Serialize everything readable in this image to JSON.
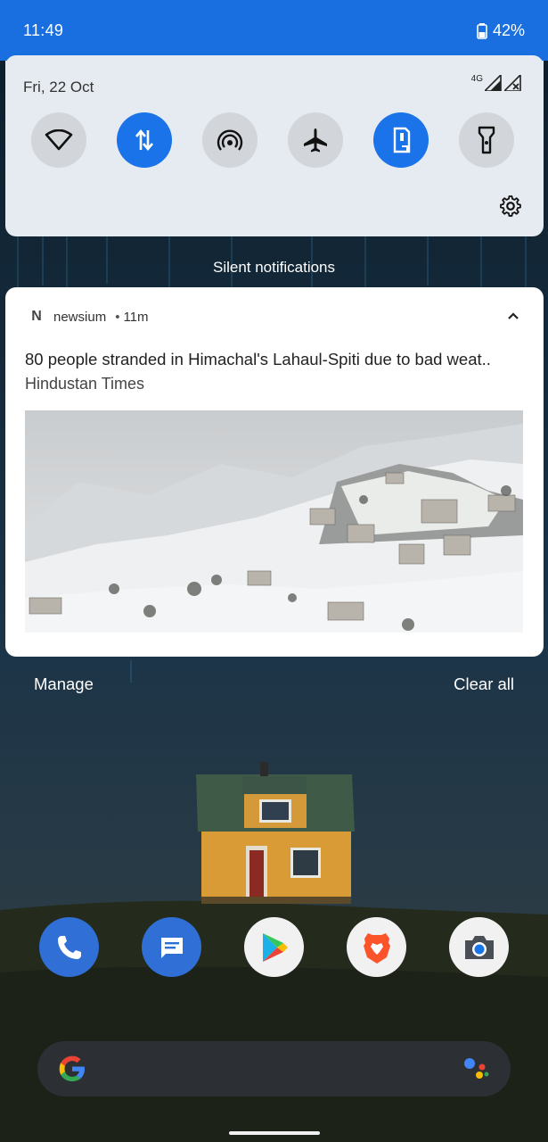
{
  "status_bar": {
    "time": "11:49",
    "battery_percent": "42%"
  },
  "quick_settings": {
    "date": "Fri, 22 Oct",
    "network_label": "4G",
    "tiles": [
      {
        "name": "wifi",
        "icon": "wifi-icon",
        "active": false
      },
      {
        "name": "mobile-data",
        "icon": "data-arrows-icon",
        "active": true
      },
      {
        "name": "hotspot",
        "icon": "hotspot-icon",
        "active": false
      },
      {
        "name": "airplane-mode",
        "icon": "airplane-icon",
        "active": false
      },
      {
        "name": "auto-rotate",
        "icon": "auto-rotate-icon",
        "active": true
      },
      {
        "name": "flashlight",
        "icon": "flashlight-icon",
        "active": false
      }
    ]
  },
  "notifications": {
    "section_label": "Silent notifications",
    "items": [
      {
        "app_icon": "N",
        "app_name": "newsium",
        "separator": "•",
        "time": "11m",
        "title": "80 people stranded in Himachal's Lahaul-Spiti due to bad weat..",
        "source": "Hindustan Times"
      }
    ],
    "manage_label": "Manage",
    "clear_all_label": "Clear all"
  },
  "dock": [
    "phone-icon",
    "messages-icon",
    "play-store-icon",
    "brave-browser-icon",
    "camera-icon"
  ],
  "colors": {
    "accent": "#1a73e8",
    "status_bar": "#1a6fe0",
    "panel": "#e6ebf1"
  }
}
